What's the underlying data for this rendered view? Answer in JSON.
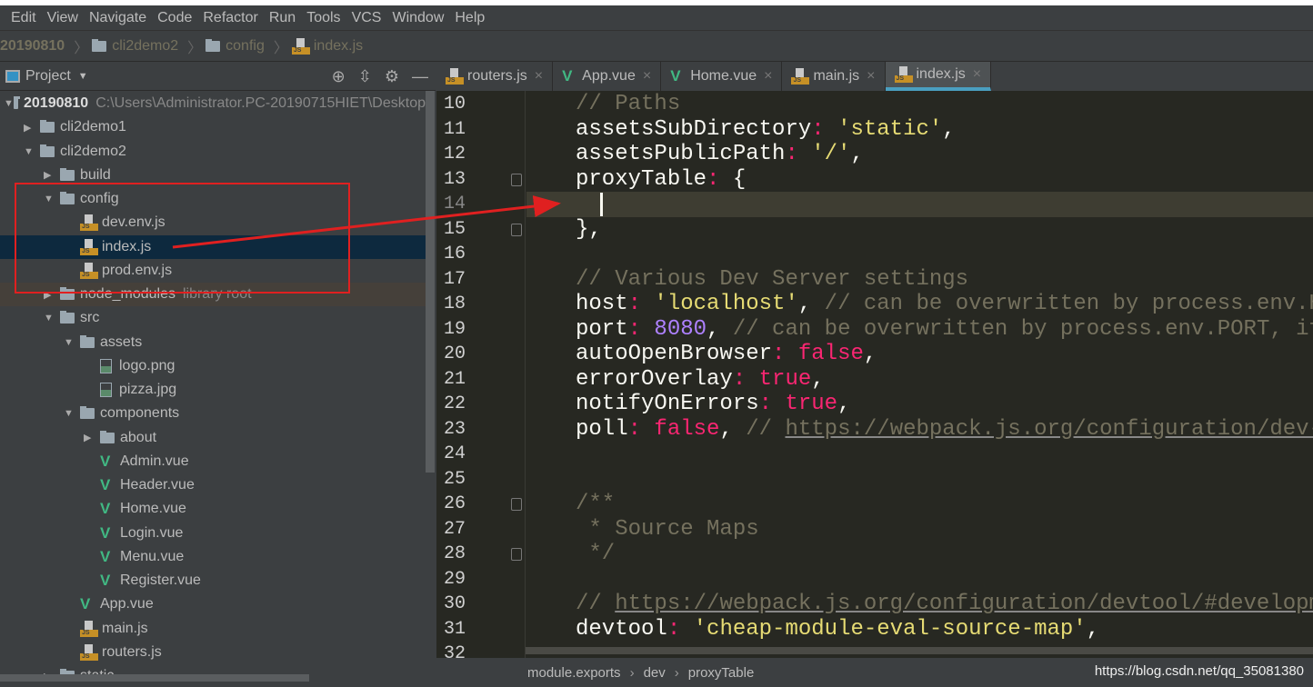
{
  "menu": [
    "Edit",
    "View",
    "Navigate",
    "Code",
    "Refactor",
    "Run",
    "Tools",
    "VCS",
    "Window",
    "Help"
  ],
  "breadcrumb": [
    {
      "label": "20190810",
      "icon": "none"
    },
    {
      "label": "cli2demo2",
      "icon": "folder"
    },
    {
      "label": "config",
      "icon": "folder"
    },
    {
      "label": "index.js",
      "icon": "js"
    }
  ],
  "project_panel": {
    "title": "Project"
  },
  "tree": [
    {
      "label": "20190810",
      "level": 0,
      "type": "folder",
      "open": true,
      "bold": true,
      "extra": "C:\\Users\\Administrator.PC-20190715HIET\\Desktop"
    },
    {
      "label": "cli2demo1",
      "level": 1,
      "type": "folder",
      "open": false
    },
    {
      "label": "cli2demo2",
      "level": 1,
      "type": "folder",
      "open": true
    },
    {
      "label": "build",
      "level": 2,
      "type": "folder",
      "open": false
    },
    {
      "label": "config",
      "level": 2,
      "type": "folder",
      "open": true
    },
    {
      "label": "dev.env.js",
      "level": 3,
      "type": "js"
    },
    {
      "label": "index.js",
      "level": 3,
      "type": "js",
      "selected": true
    },
    {
      "label": "prod.env.js",
      "level": 3,
      "type": "js"
    },
    {
      "label": "node_modules",
      "level": 2,
      "type": "folder",
      "open": false,
      "extra": "library root",
      "library": true
    },
    {
      "label": "src",
      "level": 2,
      "type": "folder",
      "open": true
    },
    {
      "label": "assets",
      "level": 3,
      "type": "folder",
      "open": true
    },
    {
      "label": "logo.png",
      "level": 4,
      "type": "image"
    },
    {
      "label": "pizza.jpg",
      "level": 4,
      "type": "image"
    },
    {
      "label": "components",
      "level": 3,
      "type": "folder",
      "open": true
    },
    {
      "label": "about",
      "level": 4,
      "type": "folder",
      "open": false
    },
    {
      "label": "Admin.vue",
      "level": 4,
      "type": "vue"
    },
    {
      "label": "Header.vue",
      "level": 4,
      "type": "vue"
    },
    {
      "label": "Home.vue",
      "level": 4,
      "type": "vue"
    },
    {
      "label": "Login.vue",
      "level": 4,
      "type": "vue"
    },
    {
      "label": "Menu.vue",
      "level": 4,
      "type": "vue"
    },
    {
      "label": "Register.vue",
      "level": 4,
      "type": "vue"
    },
    {
      "label": "App.vue",
      "level": 3,
      "type": "vue"
    },
    {
      "label": "main.js",
      "level": 3,
      "type": "js"
    },
    {
      "label": "routers.js",
      "level": 3,
      "type": "js"
    },
    {
      "label": "static",
      "level": 2,
      "type": "folder",
      "open": false
    }
  ],
  "tabs": [
    {
      "label": "routers.js",
      "icon": "js"
    },
    {
      "label": "App.vue",
      "icon": "vue"
    },
    {
      "label": "Home.vue",
      "icon": "vue"
    },
    {
      "label": "main.js",
      "icon": "js"
    },
    {
      "label": "index.js",
      "icon": "js",
      "active": true
    }
  ],
  "editor": {
    "current_line": 14,
    "lines": [
      {
        "n": "10",
        "t": [
          [
            "c",
            "// Paths"
          ]
        ]
      },
      {
        "n": "11",
        "t": [
          [
            "k",
            "assetsSubDirectory"
          ],
          [
            "p",
            ":"
          ],
          [
            "k",
            " "
          ],
          [
            "s",
            "'static'"
          ],
          [
            "k",
            ","
          ]
        ]
      },
      {
        "n": "12",
        "t": [
          [
            "k",
            "assetsPublicPath"
          ],
          [
            "p",
            ":"
          ],
          [
            "k",
            " "
          ],
          [
            "s",
            "'/'"
          ],
          [
            "k",
            ","
          ]
        ]
      },
      {
        "n": "13",
        "t": [
          [
            "k",
            "proxyTable"
          ],
          [
            "p",
            ":"
          ],
          [
            "k",
            " {"
          ]
        ],
        "fold": true
      },
      {
        "n": "14",
        "t": []
      },
      {
        "n": "15",
        "t": [
          [
            "k",
            "},"
          ]
        ],
        "fold": true
      },
      {
        "n": "16",
        "t": []
      },
      {
        "n": "17",
        "t": [
          [
            "c",
            "// Various Dev Server settings"
          ]
        ]
      },
      {
        "n": "18",
        "t": [
          [
            "k",
            "host"
          ],
          [
            "p",
            ":"
          ],
          [
            "k",
            " "
          ],
          [
            "s",
            "'localhost'"
          ],
          [
            "k",
            ", "
          ],
          [
            "c",
            "// can be overwritten by process.env.HOST"
          ]
        ]
      },
      {
        "n": "19",
        "t": [
          [
            "k",
            "port"
          ],
          [
            "p",
            ":"
          ],
          [
            "k",
            " "
          ],
          [
            "n",
            "8080"
          ],
          [
            "k",
            ", "
          ],
          [
            "c",
            "// can be overwritten by process.env.PORT, if port is in use"
          ]
        ]
      },
      {
        "n": "20",
        "t": [
          [
            "k",
            "autoOpenBrowser"
          ],
          [
            "p",
            ":"
          ],
          [
            "k",
            " "
          ],
          [
            "b",
            "false"
          ],
          [
            "k",
            ","
          ]
        ]
      },
      {
        "n": "21",
        "t": [
          [
            "k",
            "errorOverlay"
          ],
          [
            "p",
            ":"
          ],
          [
            "k",
            " "
          ],
          [
            "b",
            "true"
          ],
          [
            "k",
            ","
          ]
        ]
      },
      {
        "n": "22",
        "t": [
          [
            "k",
            "notifyOnErrors"
          ],
          [
            "p",
            ":"
          ],
          [
            "k",
            " "
          ],
          [
            "b",
            "true"
          ],
          [
            "k",
            ","
          ]
        ]
      },
      {
        "n": "23",
        "t": [
          [
            "k",
            "poll"
          ],
          [
            "p",
            ":"
          ],
          [
            "k",
            " "
          ],
          [
            "b",
            "false"
          ],
          [
            "k",
            ", "
          ],
          [
            "c",
            "// "
          ],
          [
            "u",
            "https://webpack.js.org/configuration/dev-server/"
          ]
        ]
      },
      {
        "n": "24",
        "t": []
      },
      {
        "n": "25",
        "t": []
      },
      {
        "n": "26",
        "t": [
          [
            "c",
            "/**"
          ]
        ],
        "fold": true
      },
      {
        "n": "27",
        "t": [
          [
            "c",
            " * Source Maps"
          ]
        ]
      },
      {
        "n": "28",
        "t": [
          [
            "c",
            " */"
          ]
        ],
        "fold": true
      },
      {
        "n": "29",
        "t": []
      },
      {
        "n": "30",
        "t": [
          [
            "c",
            "// "
          ],
          [
            "u",
            "https://webpack.js.org/configuration/devtool/#development"
          ]
        ]
      },
      {
        "n": "31",
        "t": [
          [
            "k",
            "devtool"
          ],
          [
            "p",
            ":"
          ],
          [
            "k",
            " "
          ],
          [
            "s",
            "'cheap-module-eval-source-map'"
          ],
          [
            "k",
            ","
          ]
        ]
      },
      {
        "n": "32",
        "t": []
      }
    ]
  },
  "status": {
    "path": [
      "module.exports",
      "dev",
      "proxyTable"
    ],
    "watermark": "https://blog.csdn.net/qq_35081380"
  },
  "colors": {
    "annotation": "#e02020",
    "accent": "#4a9fc0"
  }
}
